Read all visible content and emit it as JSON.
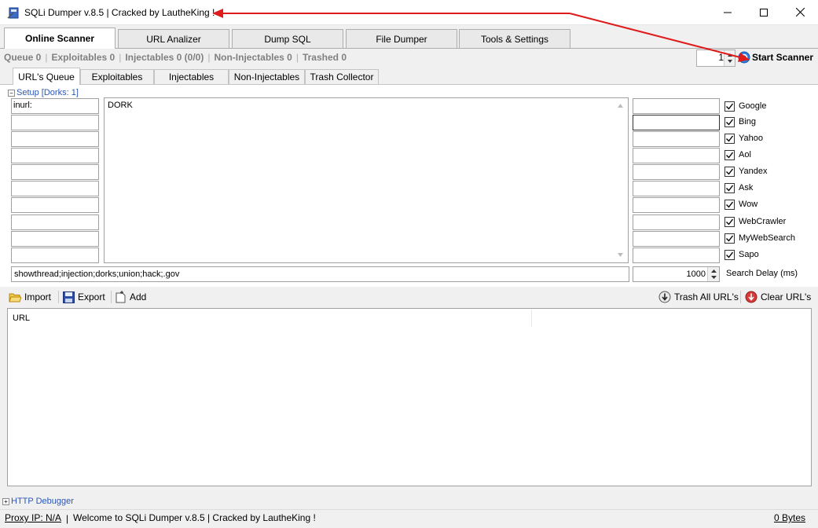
{
  "window": {
    "title": "SQLi Dumper v.8.5 | Cracked by LautheKing !"
  },
  "main_tabs": [
    {
      "label": "Online Scanner",
      "active": true
    },
    {
      "label": "URL Analizer",
      "active": false
    },
    {
      "label": "Dump SQL",
      "active": false
    },
    {
      "label": "File Dumper",
      "active": false
    },
    {
      "label": "Tools & Settings",
      "active": false
    }
  ],
  "stats": {
    "queue": "Queue 0",
    "exploitables": "Exploitables 0",
    "injectables": "Injectables 0 (0/0)",
    "non_injectables": "Non-Injectables 0",
    "trashed": "Trashed 0"
  },
  "scanner": {
    "threads": "1",
    "start_label": "Start Scanner"
  },
  "sub_tabs": [
    {
      "label": "URL's Queue",
      "active": true
    },
    {
      "label": "Exploitables",
      "active": false
    },
    {
      "label": "Injectables",
      "active": false
    },
    {
      "label": "Non-Injectables",
      "active": false
    },
    {
      "label": "Trash Collector",
      "active": false
    }
  ],
  "setup": {
    "label": "Setup [Dorks: 1]",
    "prefix_first": "inurl:",
    "dork_text": "DORK",
    "keywords": "showthread;injection;dorks;union;hack;.gov",
    "search_delay_value": "1000",
    "search_delay_label": "Search Delay (ms)"
  },
  "engines": [
    {
      "label": "Google",
      "checked": true
    },
    {
      "label": "Bing",
      "checked": true
    },
    {
      "label": "Yahoo",
      "checked": true
    },
    {
      "label": "Aol",
      "checked": true
    },
    {
      "label": "Yandex",
      "checked": true
    },
    {
      "label": "Ask",
      "checked": true
    },
    {
      "label": "Wow",
      "checked": true
    },
    {
      "label": "WebCrawler",
      "checked": true
    },
    {
      "label": "MyWebSearch",
      "checked": true
    },
    {
      "label": "Sapo",
      "checked": true
    }
  ],
  "toolbar": {
    "import": "Import",
    "export": "Export",
    "add": "Add",
    "trash_all": "Trash All URL's",
    "clear": "Clear URL's"
  },
  "url_list": {
    "column_header": "URL"
  },
  "http_debugger": {
    "label": "HTTP Debugger"
  },
  "statusbar": {
    "proxy": "Proxy IP: N/A",
    "separator": "|",
    "welcome": "Welcome to SQLi Dumper v.8.5 | Cracked by LautheKing !",
    "bytes": "0 Bytes"
  },
  "colors": {
    "link_blue": "#2b57b5",
    "annotation_red": "#e01b1b"
  }
}
